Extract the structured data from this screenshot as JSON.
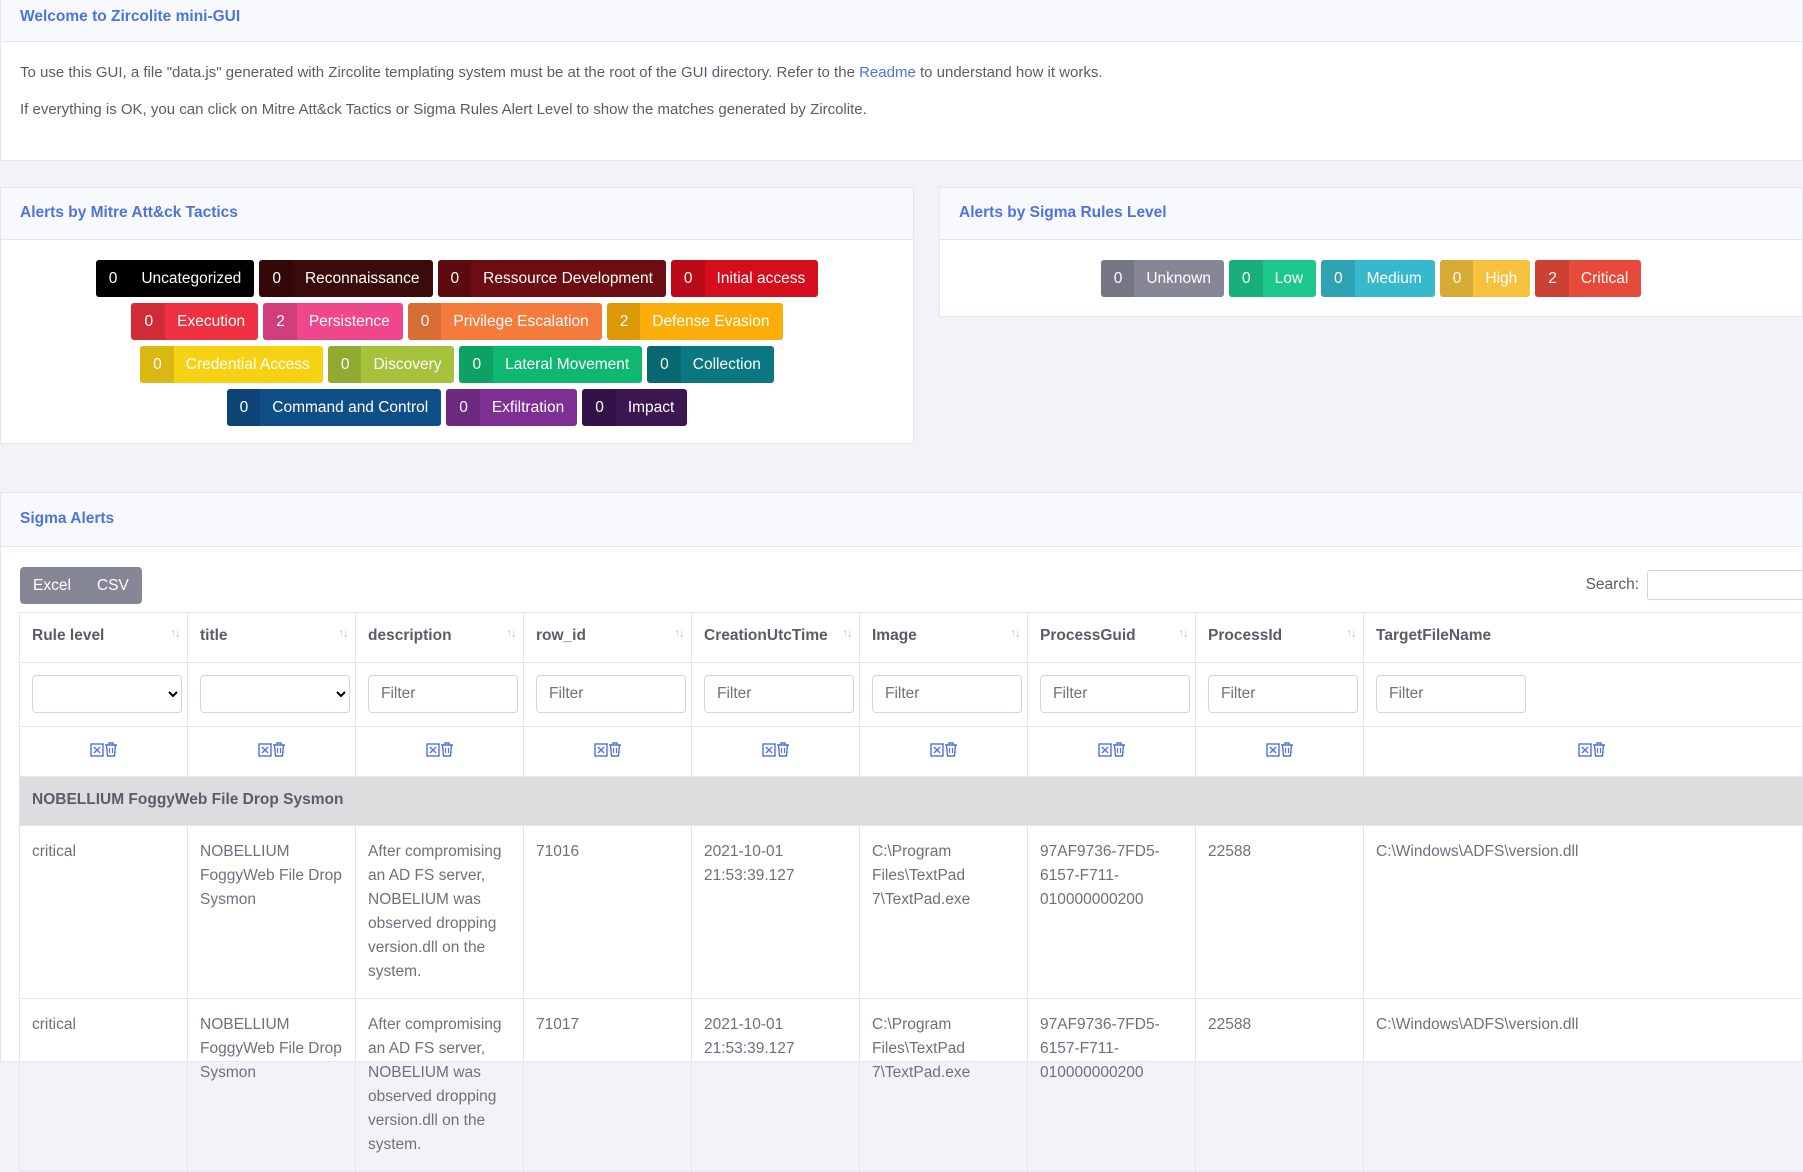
{
  "welcome": {
    "title": "Welcome to Zircolite mini-GUI",
    "line1_prefix": "To use this GUI, a file \"data.js\" generated with Zircolite templating system must be at the root of the GUI directory. Refer to the",
    "readme_link": "Readme",
    "line1_suffix": "to understand how it works.",
    "line2": "If everything is OK, you can click on Mitre Att&ck Tactics or Sigma Rules Alert Level to show the matches generated by Zircolite."
  },
  "tactics": {
    "title": "Alerts by Mitre Att&ck Tactics",
    "items": [
      {
        "count": "0",
        "label": "Uncategorized",
        "color": "#000000"
      },
      {
        "count": "0",
        "label": "Reconnaissance",
        "color": "#3b0a0a"
      },
      {
        "count": "0",
        "label": "Ressource Development",
        "color": "#6b0d12"
      },
      {
        "count": "0",
        "label": "Initial access",
        "color": "#d60d1c"
      },
      {
        "count": "0",
        "label": "Execution",
        "color": "#ee3140"
      },
      {
        "count": "2",
        "label": "Persistence",
        "color": "#f0468c"
      },
      {
        "count": "0",
        "label": "Privilege Escalation",
        "color": "#f57b3c"
      },
      {
        "count": "2",
        "label": "Defense Evasion",
        "color": "#fbae0a"
      },
      {
        "count": "0",
        "label": "Credential Access",
        "color": "#f7d214"
      },
      {
        "count": "0",
        "label": "Discovery",
        "color": "#a4c23a"
      },
      {
        "count": "0",
        "label": "Lateral Movement",
        "color": "#0fb871"
      },
      {
        "count": "0",
        "label": "Collection",
        "color": "#0a7782"
      },
      {
        "count": "0",
        "label": "Command and Control",
        "color": "#0f4e86"
      },
      {
        "count": "0",
        "label": "Exfiltration",
        "color": "#7e2f93"
      },
      {
        "count": "0",
        "label": "Impact",
        "color": "#3b1651"
      }
    ]
  },
  "levels": {
    "title": "Alerts by Sigma Rules Level",
    "items": [
      {
        "count": "0",
        "label": "Unknown",
        "color": "#858796"
      },
      {
        "count": "0",
        "label": "Low",
        "color": "#1cc88a"
      },
      {
        "count": "0",
        "label": "Medium",
        "color": "#36b9cc"
      },
      {
        "count": "0",
        "label": "High",
        "color": "#f6c23e"
      },
      {
        "count": "2",
        "label": "Critical",
        "color": "#e74a3b"
      }
    ]
  },
  "alerts": {
    "title": "Sigma Alerts",
    "buttons": {
      "excel": "Excel",
      "csv": "CSV"
    },
    "search_label": "Search:",
    "filter_placeholder": "Filter",
    "columns": [
      "Rule level",
      "title",
      "description",
      "row_id",
      "CreationUtcTime",
      "Image",
      "ProcessGuid",
      "ProcessId",
      "TargetFileName"
    ],
    "group": "NOBELLIUM FoggyWeb File Drop Sysmon",
    "rows": [
      [
        "critical",
        "NOBELLIUM FoggyWeb File Drop Sysmon",
        "After compromising an AD FS server, NOBELIUM was observed dropping version.dll on the system.",
        "71016",
        "2021-10-01 21:53:39.127",
        "C:\\Program Files\\TextPad 7\\TextPad.exe",
        "97AF9736-7FD5-6157-F711-010000000200",
        "22588",
        "C:\\Windows\\ADFS\\version.dll"
      ],
      [
        "critical",
        "NOBELLIUM FoggyWeb File Drop Sysmon",
        "After compromising an AD FS server, NOBELIUM was observed dropping version.dll on the system.",
        "71017",
        "2021-10-01 21:53:39.127",
        "C:\\Program Files\\TextPad 7\\TextPad.exe",
        "97AF9736-7FD5-6157-F711-010000000200",
        "22588",
        "C:\\Windows\\ADFS\\version.dll"
      ]
    ]
  }
}
